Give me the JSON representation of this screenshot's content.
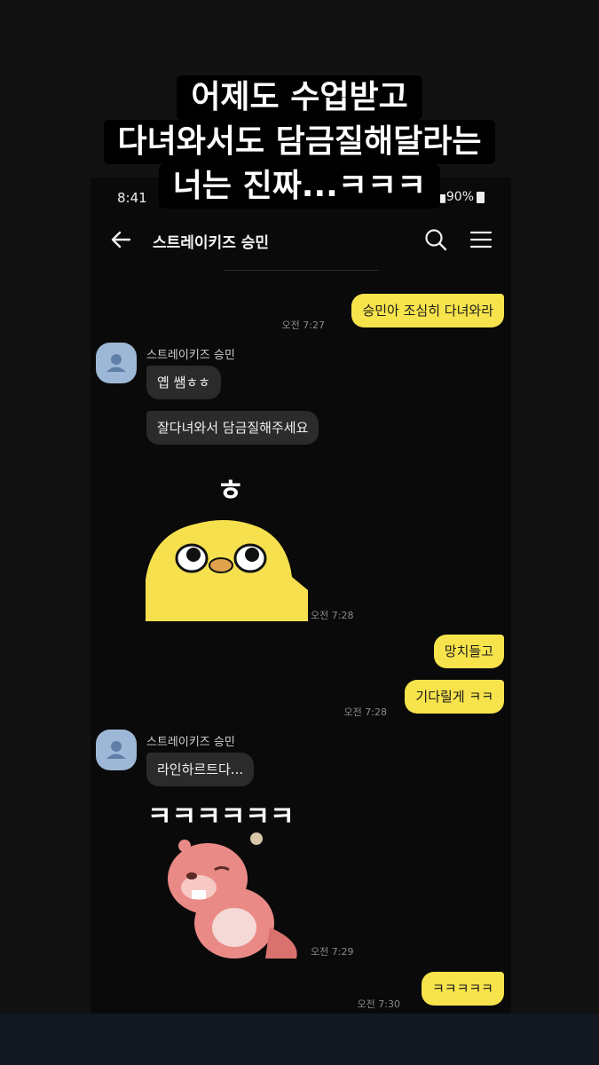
{
  "caption": {
    "line1": "어제도 수업받고",
    "line2": "다녀와서도 담금질해달라는",
    "line3": "너는 진짜...ㅋㅋㅋ"
  },
  "status_bar": {
    "time": "8:41",
    "battery": "90%"
  },
  "header": {
    "title": "스트레이키즈 승민"
  },
  "messages": [
    {
      "text": "승민아 조심히 다녀와라",
      "time": "오전 7:27"
    },
    {
      "sender": "스트레이키즈 승민"
    },
    {
      "text": "옙 쌤ㅎㅎ"
    },
    {
      "text": "잘다녀와서 담금질해주세요",
      "sticker_text": "ㅎ",
      "time": "오전 7:28"
    },
    {
      "text": "망치들고"
    },
    {
      "text": "기다릴게 ㅋㅋ",
      "time": "오전 7:28"
    },
    {
      "sender": "스트레이키즈 승민"
    },
    {
      "text": "라인하르트다...",
      "sticker_text": "ㅋㅋㅋㅋㅋㅋ",
      "time": "오전 7:29"
    },
    {
      "text": "ㅋㅋㅋㅋㅋ",
      "time": "오전 7:30"
    }
  ],
  "colors": {
    "my_bubble": "#f7e34b",
    "other_bubble": "#2b2b2b",
    "background": "#0a0a0a",
    "avatar": "#9db8d6"
  }
}
